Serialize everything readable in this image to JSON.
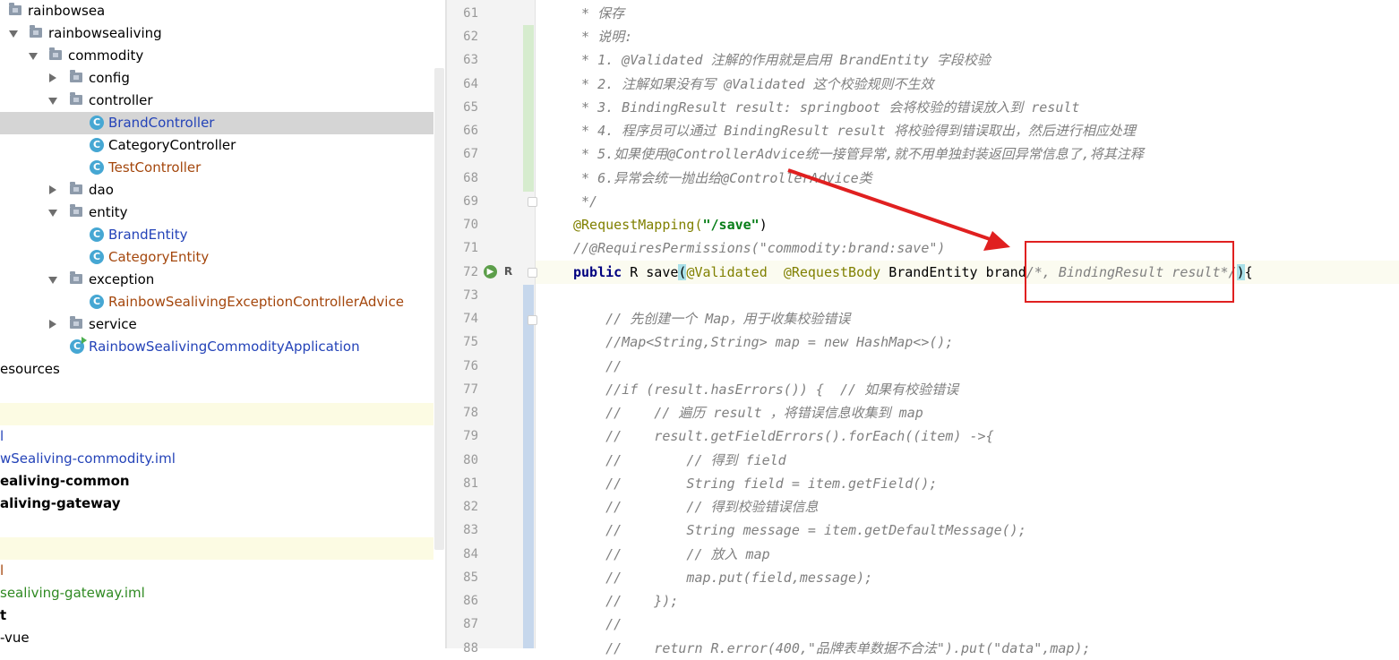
{
  "tree": {
    "items": [
      {
        "label": "rainbowsea"
      },
      {
        "label": "rainbowsealiving"
      },
      {
        "label": "commodity"
      },
      {
        "label": "config"
      },
      {
        "label": "controller"
      },
      {
        "label": "BrandController"
      },
      {
        "label": "CategoryController"
      },
      {
        "label": "TestController"
      },
      {
        "label": "dao"
      },
      {
        "label": "entity"
      },
      {
        "label": "BrandEntity"
      },
      {
        "label": "CategoryEntity"
      },
      {
        "label": "exception"
      },
      {
        "label": "RainbowSealivingExceptionControllerAdvice"
      },
      {
        "label": "service"
      },
      {
        "label": "RainbowSealivingCommodityApplication"
      },
      {
        "label": "esources"
      },
      {
        "label": "l"
      },
      {
        "label": "wSealiving-commodity.iml"
      },
      {
        "label": "ealiving-common"
      },
      {
        "label": "aliving-gateway"
      },
      {
        "label": "l"
      },
      {
        "label": "sealiving-gateway.iml"
      },
      {
        "label": "t"
      },
      {
        "label": "-vue"
      }
    ],
    "class_icon_letter": "C"
  },
  "editor": {
    "line_numbers": [
      "61",
      "62",
      "63",
      "64",
      "65",
      "66",
      "67",
      "68",
      "69",
      "70",
      "71",
      "72",
      "73",
      "74",
      "75",
      "76",
      "77",
      "78",
      "79",
      "80",
      "81",
      "82",
      "83",
      "84",
      "85",
      "86",
      "87",
      "88"
    ],
    "lines": {
      "l61": " * 保存",
      "l62": " * 说明:",
      "l63": " * 1. @Validated 注解的作用就是启用 BrandEntity 字段校验",
      "l64": " * 2. 注解如果没有写 @Validated 这个校验规则不生效",
      "l65": " * 3. BindingResult result: springboot 会将校验的错误放入到 result",
      "l66": " * 4. 程序员可以通过 BindingResult result 将校验得到错误取出，然后进行相应处理",
      "l67": " * 5.如果使用@ControllerAdvice统一接管异常,就不用单独封装返回异常信息了,将其注释",
      "l68": " * 6.异常会统一抛出给@ControllerAdvice类",
      "l69": " */",
      "l70_ann": "@RequestMapping(",
      "l70_str": "\"/save\"",
      "l70_end": ")",
      "l71": "//@RequiresPermissions(\"commodity:brand:save\")",
      "l72_kw": "public",
      "l72_a": " R save",
      "l72_paren": "(",
      "l72_ann1": "@Validated",
      "l72_sp": "  ",
      "l72_ann2": "@RequestBody",
      "l72_b": " BrandEntity brand",
      "l72_cmt": "/*, BindingResult result*/",
      "l72_close": ")",
      "l72_end": "{",
      "l74": "    // 先创建一个 Map，用于收集校验错误",
      "l75": "    //Map<String,String> map = new HashMap<>();",
      "l76": "    //",
      "l77": "    //if (result.hasErrors()) {  // 如果有校验错误",
      "l78": "    //    // 遍历 result ，将错误信息收集到 map",
      "l79": "    //    result.getFieldErrors().forEach((item) ->{",
      "l80": "    //        // 得到 field",
      "l81": "    //        String field = item.getField();",
      "l82": "    //        // 得到校验错误信息",
      "l83": "    //        String message = item.getDefaultMessage();",
      "l84": "    //        // 放入 map",
      "l85": "    //        map.put(field,message);",
      "l86": "    //    });",
      "l87": "    //",
      "l88": "    //    return R.error(400,\"品牌表单数据不合法\").put(\"data\",map);"
    },
    "gutter_icons": {
      "run": "run-icon",
      "edit": "R"
    }
  },
  "colors": {
    "selection": "#d5d5d5",
    "annotation_box": "#e02020",
    "comment": "#808080",
    "annotation": "#808000",
    "keyword": "#000080",
    "string": "#067d17"
  }
}
